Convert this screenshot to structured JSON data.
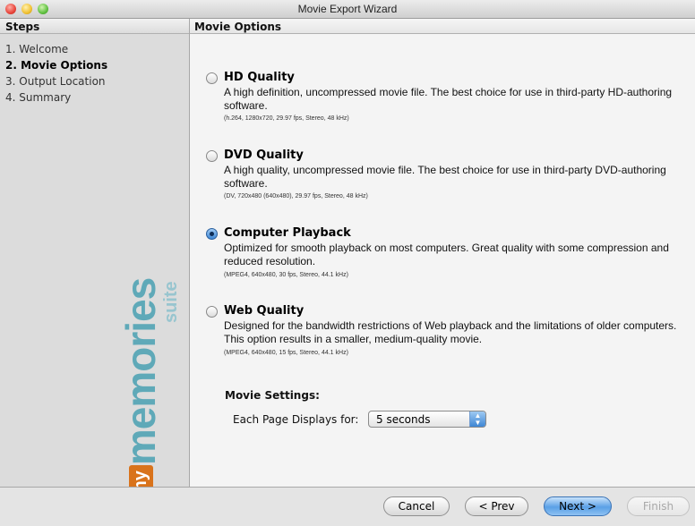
{
  "window": {
    "title": "Movie Export Wizard"
  },
  "sidebar": {
    "header": "Steps",
    "steps": [
      {
        "label": "1. Welcome"
      },
      {
        "label": "2. Movie Options",
        "active": true
      },
      {
        "label": "3. Output Location"
      },
      {
        "label": "4. Summary"
      }
    ],
    "brand": {
      "my": "my",
      "memories": "memories",
      "suite": "suite"
    }
  },
  "main": {
    "header": "Movie Options",
    "options": [
      {
        "title": "HD Quality",
        "description": "A high definition, uncompressed movie file. The best choice for use in third-party HD-authoring software.",
        "spec": "(h.264, 1280x720, 29.97 fps, Stereo, 48 kHz)",
        "selected": false
      },
      {
        "title": "DVD Quality",
        "description": "A high quality, uncompressed movie file. The best choice for use in third-party DVD-authoring software.",
        "spec": "(DV, 720x480 (640x480), 29.97 fps, Stereo, 48 kHz)",
        "selected": false
      },
      {
        "title": "Computer Playback",
        "description": "Optimized for smooth playback on most computers. Great quality with some compression and reduced resolution.",
        "spec": "(MPEG4, 640x480, 30 fps, Stereo, 44.1 kHz)",
        "selected": true
      },
      {
        "title": "Web Quality",
        "description": "Designed for the bandwidth restrictions of Web playback and the limitations of older computers. This option results in a smaller, medium-quality movie.",
        "spec": "(MPEG4, 640x480, 15 fps, Stereo, 44.1 kHz)",
        "selected": false
      }
    ],
    "settings": {
      "header": "Movie Settings:",
      "page_display_label": "Each Page Displays for:",
      "page_display_value": "5 seconds"
    }
  },
  "buttons": {
    "cancel": "Cancel",
    "prev": "< Prev",
    "next": "Next >",
    "finish": "Finish"
  },
  "colors": {
    "accent": "#3e86d4",
    "brand_orange": "#d9731b",
    "brand_teal": "#5fa9b8"
  }
}
